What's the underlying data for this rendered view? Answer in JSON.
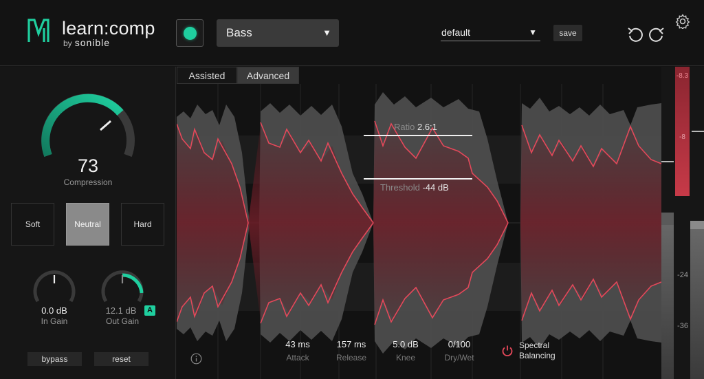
{
  "header": {
    "app_name": "learn:comp",
    "by_label": "by",
    "brand": "sonible",
    "profile_selected": "Bass",
    "preset_selected": "default",
    "save_label": "save"
  },
  "left_panel": {
    "compression_value": "73",
    "compression_label": "Compression",
    "compression_level": 0.73,
    "modes": [
      "Soft",
      "Neutral",
      "Hard"
    ],
    "active_mode": "Neutral",
    "in_gain_value": "0.0 dB",
    "in_gain_label": "In Gain",
    "out_gain_value": "12.1 dB",
    "out_gain_label": "Out Gain",
    "auto_badge": "A",
    "bypass_label": "bypass",
    "reset_label": "reset"
  },
  "tabs": [
    "Assisted",
    "Advanced"
  ],
  "active_tab": "Advanced",
  "graph": {
    "ratio_label": "Ratio",
    "ratio_value": "2.6:1",
    "threshold_label": "Threshold",
    "threshold_value": "-44 dB"
  },
  "params": {
    "attack_value": "43 ms",
    "attack_label": "Attack",
    "release_value": "157 ms",
    "release_label": "Release",
    "knee_value": "5.0 dB",
    "knee_label": "Knee",
    "drywet_value": "0/100",
    "drywet_label": "Dry/Wet",
    "spectral_line1": "Spectral",
    "spectral_line2": "Balancing"
  },
  "meters": {
    "gr_top_label": "-8.3",
    "gr_label_1": "-8",
    "scale_24": "-24",
    "scale_36": "-36"
  },
  "colors": {
    "accent": "#1fcf9f",
    "waveform_red": "#e5485a",
    "meter_red": "#c73a48"
  }
}
